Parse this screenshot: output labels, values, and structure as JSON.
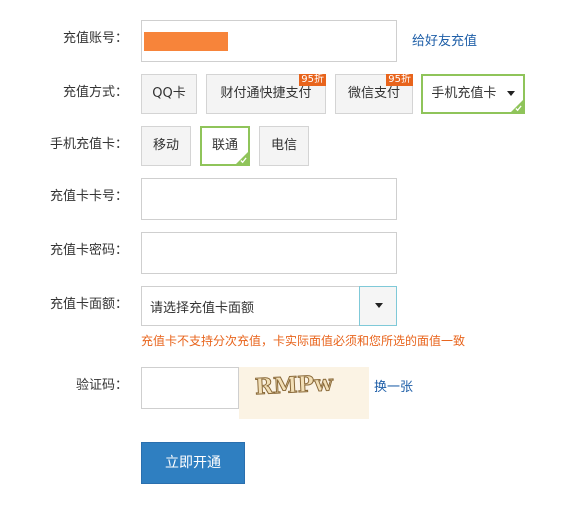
{
  "form": {
    "account": {
      "label": "充值账号：",
      "gift_link": "给好友充值",
      "mask_color": "#f7843a"
    },
    "method": {
      "label": "充值方式：",
      "options": [
        {
          "label": "QQ卡",
          "badge": ""
        },
        {
          "label": "财付通快捷支付",
          "badge": "95折"
        },
        {
          "label": "微信支付",
          "badge": "95折"
        },
        {
          "label": "手机充值卡",
          "badge": "",
          "selected": true
        }
      ]
    },
    "carrier": {
      "label": "手机充值卡：",
      "options": [
        {
          "label": "移动"
        },
        {
          "label": "联通",
          "selected": true
        },
        {
          "label": "电信"
        }
      ]
    },
    "card_number": {
      "label": "充值卡卡号：",
      "value": ""
    },
    "card_password": {
      "label": "充值卡密码：",
      "value": ""
    },
    "denomination": {
      "label": "充值卡面额：",
      "value": "请选择充值卡面额",
      "note": "充值卡不支持分次充值，卡实际面值必须和您所选的面值一致"
    },
    "captcha": {
      "label": "验证码：",
      "value": "",
      "image_text": "RMPw",
      "refresh_link": "换一张"
    },
    "submit_label": "立即开通"
  },
  "colors": {
    "accent_green": "#8fc45a",
    "discount_badge": "#e8641c",
    "primary_button": "#2f7fc1",
    "link": "#1f5fa8"
  },
  "icons": {
    "dropdown": "caret-down-icon",
    "selected_mark": "check-corner-icon"
  }
}
